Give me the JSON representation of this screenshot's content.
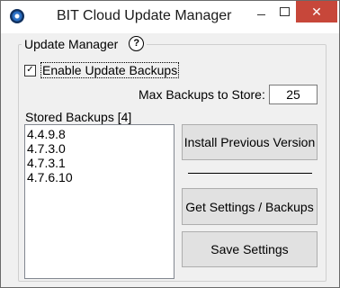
{
  "window": {
    "title": "BIT Cloud Update Manager",
    "minimize_glyph": "",
    "close_glyph": "✕"
  },
  "group": {
    "legend": "Update Manager",
    "help_glyph": "?"
  },
  "enable_backups": {
    "label": "Enable Update Backups",
    "checked": true,
    "check_glyph": "✓"
  },
  "max_backups": {
    "label": "Max Backups to Store:",
    "value": "25"
  },
  "stored_backups": {
    "label": "Stored Backups [4]",
    "items": [
      "4.4.9.8",
      "4.7.3.0",
      "4.7.3.1",
      "4.7.6.10"
    ]
  },
  "buttons": {
    "install": "Install Previous Version",
    "get": "Get Settings / Backups",
    "save": "Save Settings"
  },
  "colors": {
    "close_button": "#c7473a",
    "window_bg": "#f0f0f0",
    "button_bg": "#e1e1e1"
  }
}
